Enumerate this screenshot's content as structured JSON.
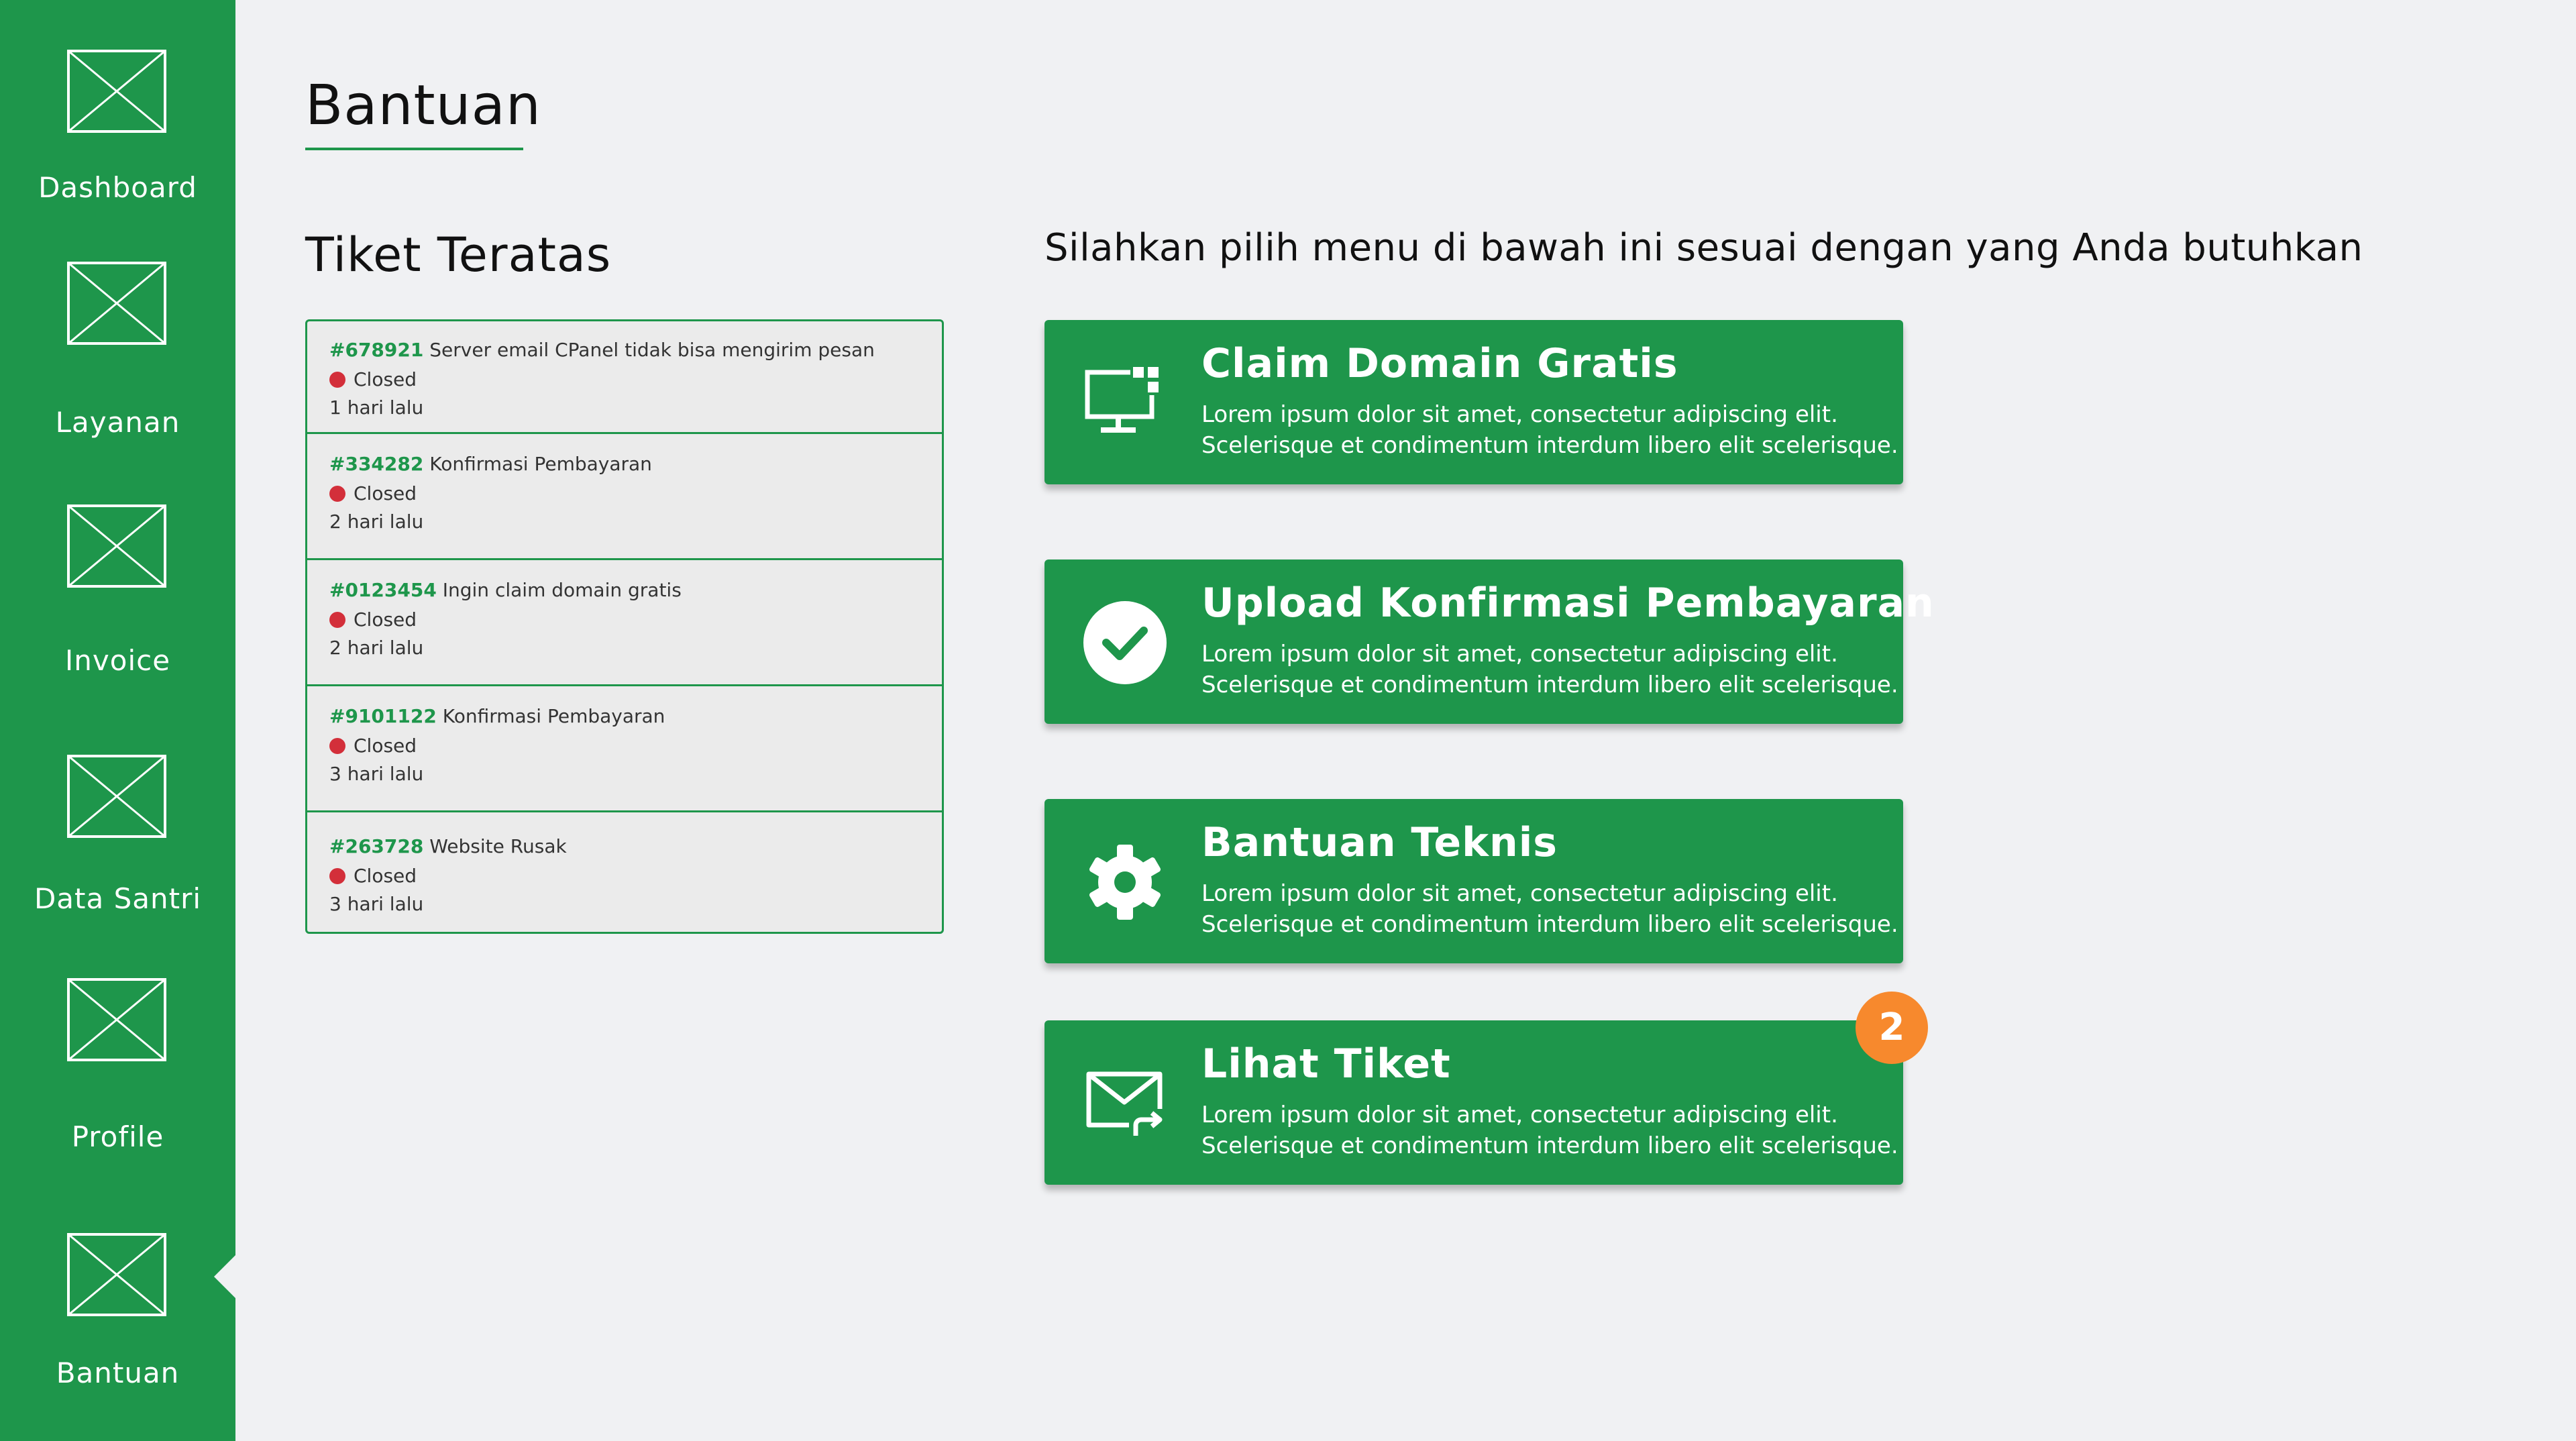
{
  "sidebar": {
    "items": [
      {
        "label": "Dashboard"
      },
      {
        "label": "Layanan"
      },
      {
        "label": "Invoice"
      },
      {
        "label": "Data Santri"
      },
      {
        "label": "Profile"
      },
      {
        "label": "Bantuan"
      }
    ],
    "active": "Bantuan"
  },
  "page": {
    "title": "Bantuan"
  },
  "tickets": {
    "heading": "Tiket Teratas",
    "items": [
      {
        "id": "#678921",
        "subject": "Server email CPanel tidak bisa mengirim pesan",
        "status": "Closed",
        "age": "1 hari lalu"
      },
      {
        "id": "#334282",
        "subject": "Konfirmasi Pembayaran",
        "status": "Closed",
        "age": "2 hari lalu"
      },
      {
        "id": "#0123454",
        "subject": "Ingin claim domain gratis",
        "status": "Closed",
        "age": "2 hari lalu"
      },
      {
        "id": "#9101122",
        "subject": "Konfirmasi Pembayaran",
        "status": "Closed",
        "age": "3 hari lalu"
      },
      {
        "id": "#263728",
        "subject": "Website Rusak",
        "status": "Closed",
        "age": "3 hari lalu"
      }
    ]
  },
  "menu": {
    "instruction": "Silahkan pilih menu di bawah ini sesuai dengan yang Anda butuhkan",
    "cards": [
      {
        "title": "Claim Domain Gratis",
        "desc1": "Lorem ipsum dolor sit amet, consectetur adipiscing elit.",
        "desc2": "Scelerisque et condimentum interdum libero elit scelerisque.",
        "icon": "monitor-grid-icon"
      },
      {
        "title": "Upload Konfirmasi Pembayaran",
        "desc1": "Lorem ipsum dolor sit amet, consectetur adipiscing elit.",
        "desc2": "Scelerisque et condimentum interdum libero elit scelerisque.",
        "icon": "check-circle-icon"
      },
      {
        "title": "Bantuan Teknis",
        "desc1": "Lorem ipsum dolor sit amet, consectetur adipiscing elit.",
        "desc2": "Scelerisque et condimentum interdum libero elit scelerisque.",
        "icon": "gear-icon"
      },
      {
        "title": "Lihat Tiket",
        "desc1": "Lorem ipsum dolor sit amet, consectetur adipiscing elit.",
        "desc2": "Scelerisque et condimentum interdum libero elit scelerisque.",
        "icon": "mail-forward-icon"
      }
    ],
    "ticket_badge": "2"
  },
  "colors": {
    "brand_green": "#1e964b",
    "status_closed": "#d32f3a",
    "badge_orange": "#f7892d",
    "background": "#f0f1f3"
  }
}
